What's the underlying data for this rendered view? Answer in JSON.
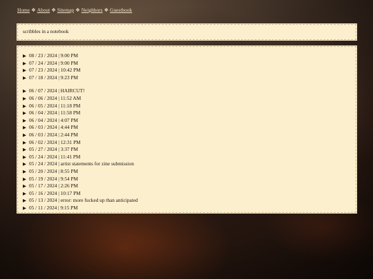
{
  "nav": {
    "links": [
      "Home",
      "About",
      "Sitemap",
      "Neighbors",
      "Guestbook"
    ],
    "separator": "❖"
  },
  "header": {
    "title": "scribbles in a notebook"
  },
  "entries_group_1": [
    "08 / 23 / 2024 | 9:00 PM",
    "07 / 24 / 2024 | 9:00 PM",
    "07 / 23 / 2024 | 10:42 PM",
    "07 / 18 / 2024 | 9:23 PM"
  ],
  "entries_group_2": [
    "06 / 07 / 2024 | HAIRCUT!",
    "06 / 06 / 2024 | 11:52 AM",
    "06 / 05 / 2024 | 11:18 PM",
    "06 / 04 / 2024 | 11:58 PM",
    "06 / 04 / 2024 | 4:07 PM",
    "06 / 03 / 2024 | 4:44 PM",
    "06 / 03 / 2024 | 2:44 PM",
    "06 / 02 / 2024 | 12:31 PM",
    "05 / 27 / 2024 | 3:37 PM",
    "05 / 24 / 2024 | 11:41 PM",
    "05 / 24 / 2024 | artist statements for zine submission",
    "05 / 20 / 2024 | 8:55 PM",
    "05 / 19 / 2024 | 9:54 PM",
    "05 / 17 / 2024 | 2:26 PM",
    "05 / 16 / 2024 | 10:17 PM",
    "05 / 13 / 2024 | error: more fucked up than anticipated",
    "05 / 11 / 2024 | 9:15 PM"
  ],
  "disclosure_icon": "▶"
}
